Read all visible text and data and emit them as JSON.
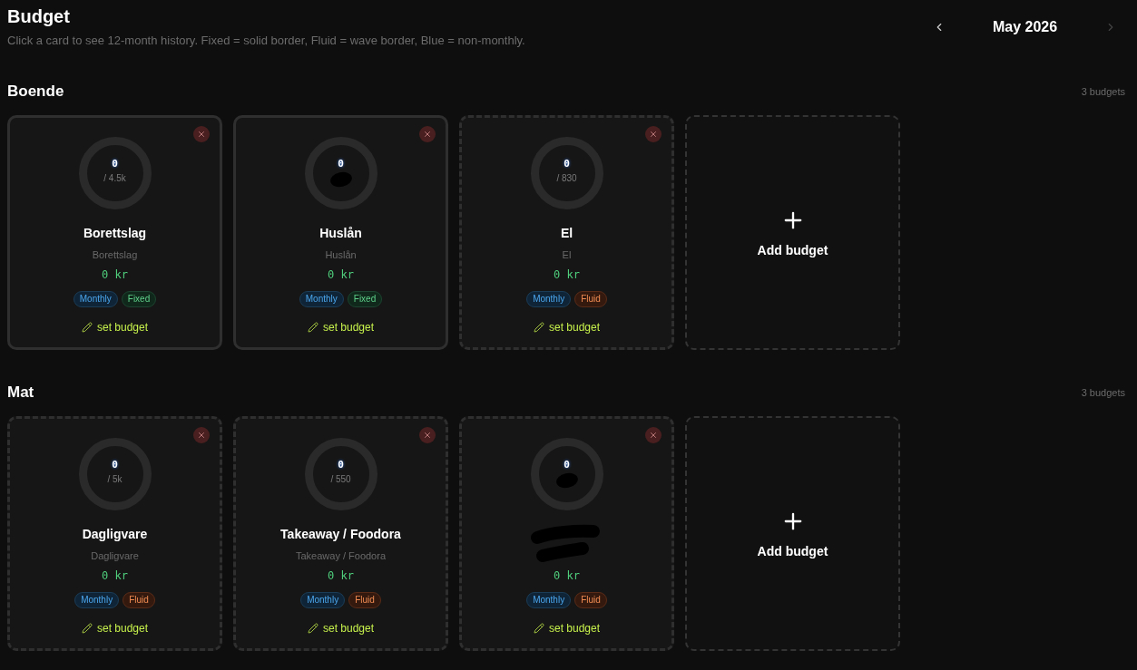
{
  "page": {
    "title": "Budget",
    "subtitle": "Click a card to see 12-month history. Fixed = solid border, Fluid = wave border, Blue = non-monthly."
  },
  "month_nav": {
    "label": "May 2026",
    "previous": {
      "disabled": false
    },
    "next": {
      "disabled": true
    }
  },
  "sections": [
    {
      "title": "Boende",
      "count": "3 budgets",
      "cards": [
        {
          "kind": "fixed",
          "spent": "0",
          "limit": "/ 4.5k",
          "title": "Borettslag",
          "subtitle": "Borettslag",
          "amount": "0 kr",
          "tags": [
            {
              "label": "Monthly",
              "kind": "period"
            },
            {
              "label": "Fixed",
              "kind": "fixed"
            }
          ],
          "action": "set budget"
        },
        {
          "kind": "fixed",
          "spent": "0",
          "title": "Huslån",
          "subtitle": "Huslån",
          "amount": "0 kr",
          "tags": [
            {
              "label": "Monthly",
              "kind": "period"
            },
            {
              "label": "Fixed",
              "kind": "fixed"
            }
          ],
          "action": "set budget"
        },
        {
          "kind": "fluid",
          "spent": "0",
          "limit": "/ 830",
          "title": "El",
          "subtitle": "El",
          "amount": "0 kr",
          "tags": [
            {
              "label": "Monthly",
              "kind": "period"
            },
            {
              "label": "Fluid",
              "kind": "fluid"
            }
          ],
          "action": "set budget"
        }
      ],
      "add_card": {
        "label": "Add budget"
      }
    },
    {
      "title": "Mat",
      "count": "3 budgets",
      "cards": [
        {
          "kind": "fluid",
          "spent": "0",
          "limit": "/ 5k",
          "title": "Dagligvare",
          "subtitle": "Dagligvare",
          "amount": "0 kr",
          "tags": [
            {
              "label": "Monthly",
              "kind": "period"
            },
            {
              "label": "Fluid",
              "kind": "fluid"
            }
          ],
          "action": "set budget"
        },
        {
          "kind": "fluid",
          "spent": "0",
          "limit": "/ 550",
          "title": "Takeaway / Foodora",
          "subtitle": "Takeaway / Foodora",
          "amount": "0 kr",
          "tags": [
            {
              "label": "Monthly",
              "kind": "period"
            },
            {
              "label": "Fluid",
              "kind": "fluid"
            }
          ],
          "action": "set budget"
        },
        {
          "kind": "fluid",
          "spent": "0",
          "amount": "0 kr",
          "tags": [
            {
              "label": "Monthly",
              "kind": "period"
            },
            {
              "label": "Fluid",
              "kind": "fluid"
            }
          ],
          "action": "set budget"
        }
      ],
      "add_card": {
        "label": "Add budget"
      }
    }
  ]
}
